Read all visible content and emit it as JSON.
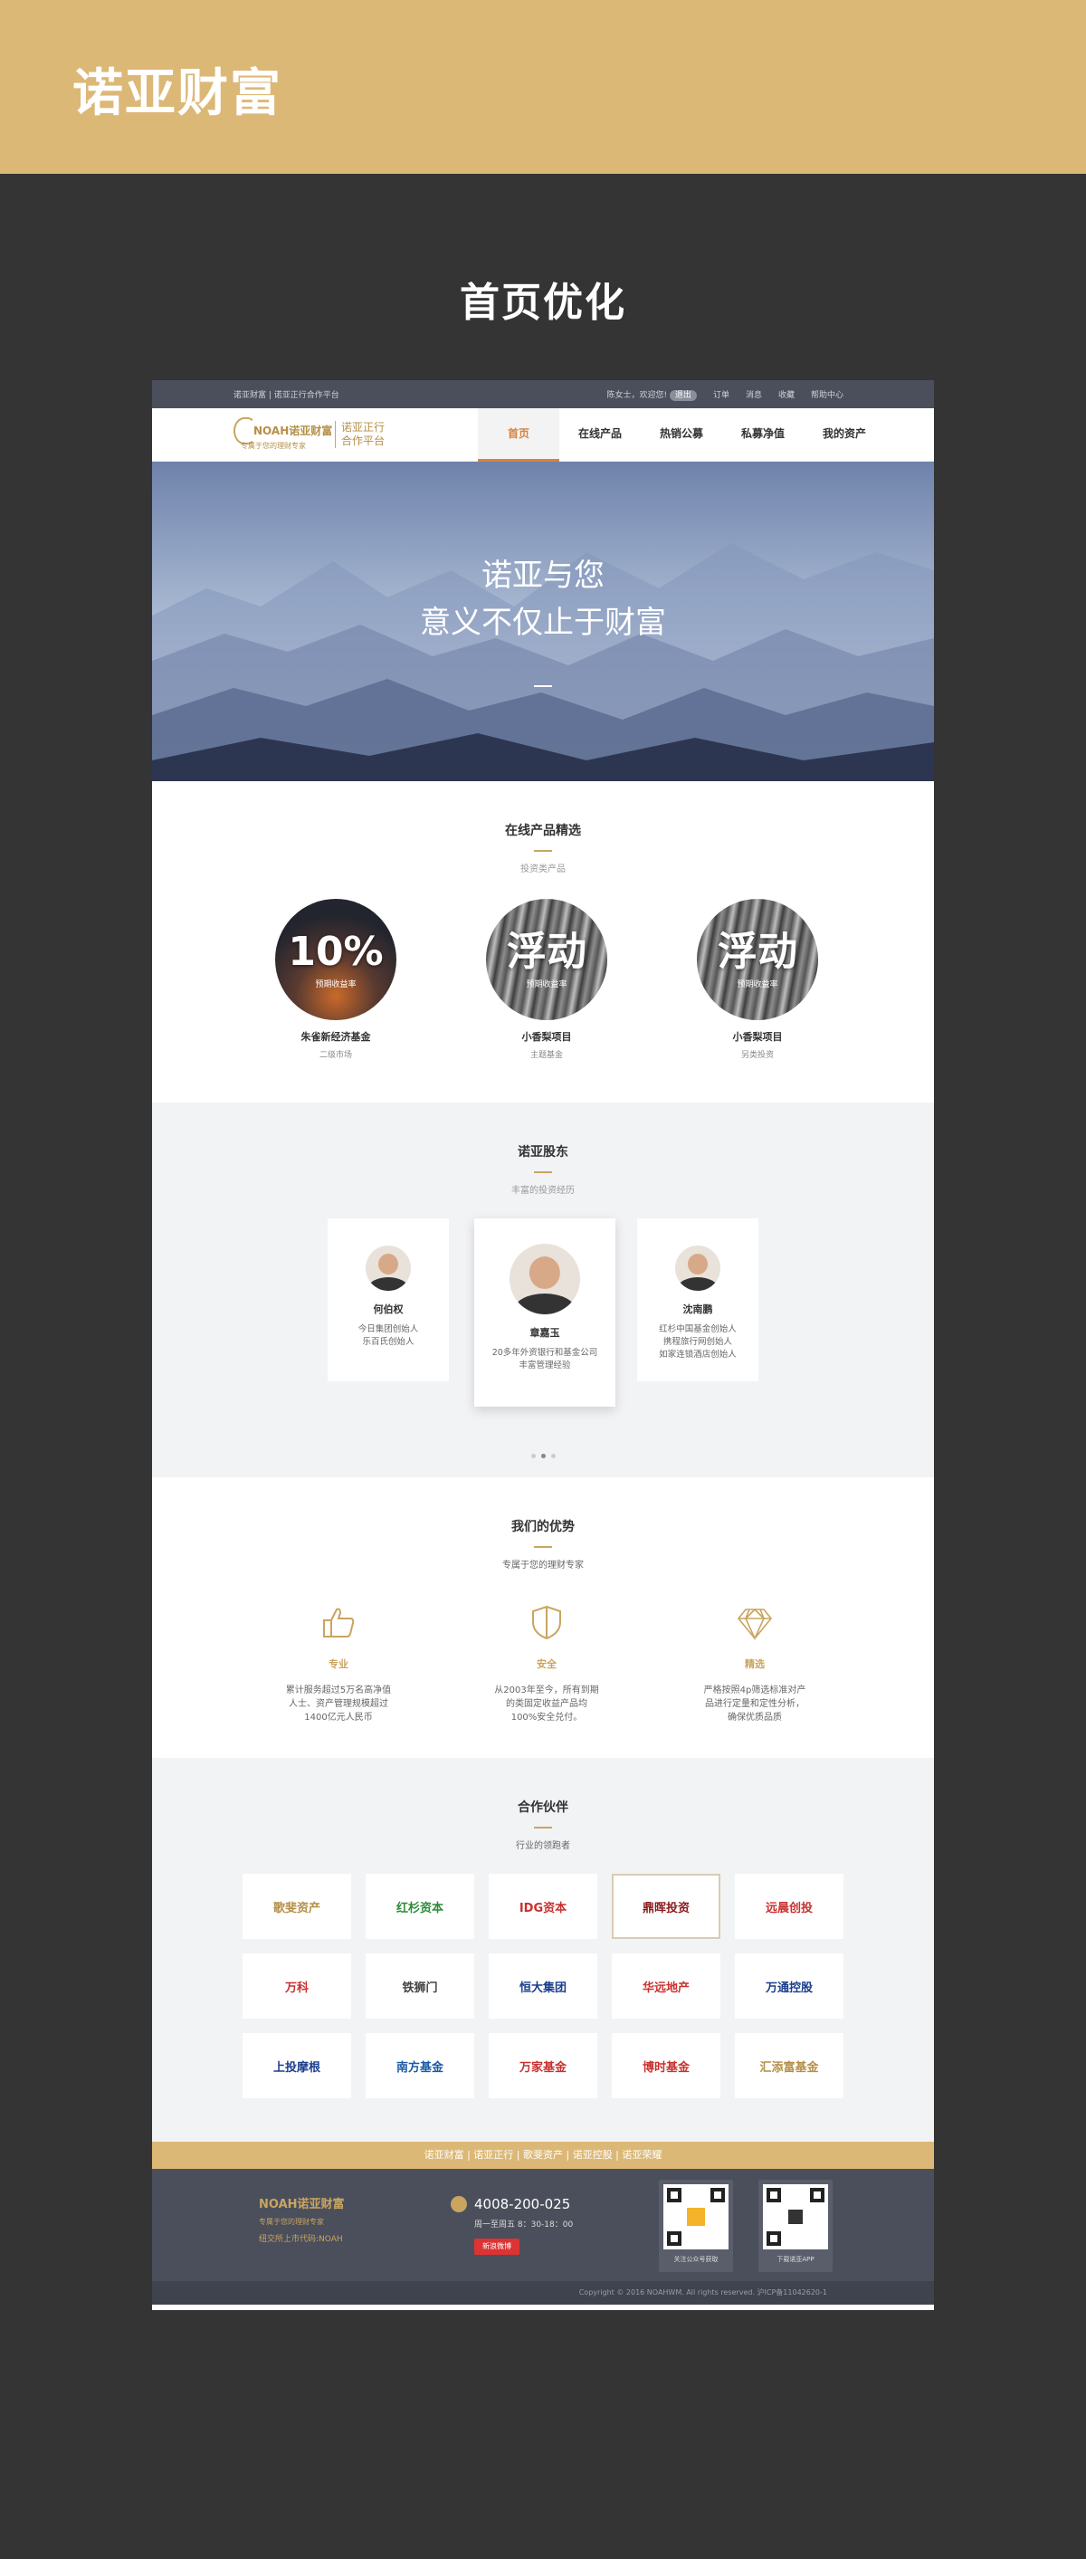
{
  "banner": {
    "title": "诺亚财富"
  },
  "page_title": "首页优化",
  "topbar": {
    "left": "诺亚财富 | 诺亚正行合作平台",
    "greeting": "陈女士，欢迎您!",
    "logout": "退出",
    "links": [
      "订单",
      "消息",
      "收藏",
      "帮助中心"
    ]
  },
  "nav": {
    "logo_name": "NOAH诺亚财富",
    "logo_slogan": "专属于您的理财专家",
    "logo_coop_1": "诺亚正行",
    "logo_coop_2": "合作平台",
    "items": [
      "首页",
      "在线产品",
      "热销公募",
      "私募净值",
      "我的资产"
    ]
  },
  "hero": {
    "line1": "诺亚与您",
    "line2": "意义不仅止于财富"
  },
  "products": {
    "title": "在线产品精选",
    "subtitle": "投资类产品",
    "items": [
      {
        "big": "10%",
        "small": "预期收益率",
        "name": "朱雀新经济基金",
        "type": "二级市场"
      },
      {
        "big": "浮动",
        "small": "预期收益率",
        "name": "小香梨项目",
        "type": "主题基金"
      },
      {
        "big": "浮动",
        "small": "预期收益率",
        "name": "小香梨项目",
        "type": "另类投资"
      }
    ]
  },
  "shareholders": {
    "title": "诺亚股东",
    "subtitle": "丰富的投资经历",
    "people": [
      {
        "name": "何伯权",
        "desc1": "今日集团创始人",
        "desc2": "乐百氏创始人",
        "desc3": ""
      },
      {
        "name": "章嘉玉",
        "desc1": "20多年外资银行和基金公司",
        "desc2": "丰富管理经验",
        "desc3": ""
      },
      {
        "name": "沈南鹏",
        "desc1": "红杉中国基金创始人",
        "desc2": "携程旅行网创始人",
        "desc3": "如家连锁酒店创始人"
      }
    ]
  },
  "advantages": {
    "title": "我们的优势",
    "subtitle": "专属于您的理财专家",
    "items": [
      {
        "icon": "thumbs-up-icon",
        "title": "专业",
        "l1": "累计服务超过5万名高净值",
        "l2": "人士、资产管理规模超过",
        "l3": "1400亿元人民币"
      },
      {
        "icon": "shield-icon",
        "title": "安全",
        "l1": "从2003年至今，所有到期",
        "l2": "的类固定收益产品均",
        "l3": "100%安全兑付。"
      },
      {
        "icon": "diamond-icon",
        "title": "精选",
        "l1": "严格按照4p筛选标准对产",
        "l2": "品进行定量和定性分析，",
        "l3": "确保优质品质"
      }
    ]
  },
  "partners": {
    "title": "合作伙伴",
    "subtitle": "行业的领跑者",
    "logos": [
      {
        "name": "歌斐资产",
        "color": "#b58f47"
      },
      {
        "name": "红杉资本",
        "color": "#2e8b3a"
      },
      {
        "name": "IDG资本",
        "color": "#c8312f"
      },
      {
        "name": "鼎晖投资",
        "color": "#8a1b1b"
      },
      {
        "name": "远晨创投",
        "color": "#c8312f"
      },
      {
        "name": "万科",
        "color": "#c8312f"
      },
      {
        "name": "铁狮门",
        "color": "#444444"
      },
      {
        "name": "恒大集团",
        "color": "#1a3e8c"
      },
      {
        "name": "华远地产",
        "color": "#c8312f"
      },
      {
        "name": "万通控股",
        "color": "#1a3e8c"
      },
      {
        "name": "上投摩根",
        "color": "#1a3e8c"
      },
      {
        "name": "南方基金",
        "color": "#1a5aa8"
      },
      {
        "name": "万家基金",
        "color": "#c8312f"
      },
      {
        "name": "博时基金",
        "color": "#c8312f"
      },
      {
        "name": "汇添富基金",
        "color": "#b58f47"
      }
    ]
  },
  "footer": {
    "bar": "诺亚财富 | 诺亚正行 | 歌斐资产 | 诺亚控股 | 诺亚荣耀",
    "logo": "NOAH诺亚财富",
    "slogan": "专属于您的理财专家",
    "listed": "纽交所上市代码:NOAH",
    "phone": "4008-200-025",
    "hours": "周一至周五 8：30-18：00",
    "weibo": "新浪微博",
    "qr1": "关注公众号获取",
    "qr2": "下载诺亚APP",
    "copyright": "Copyright © 2016 NOAHWM. All rights reserved. 沪ICP备11042620-1"
  }
}
